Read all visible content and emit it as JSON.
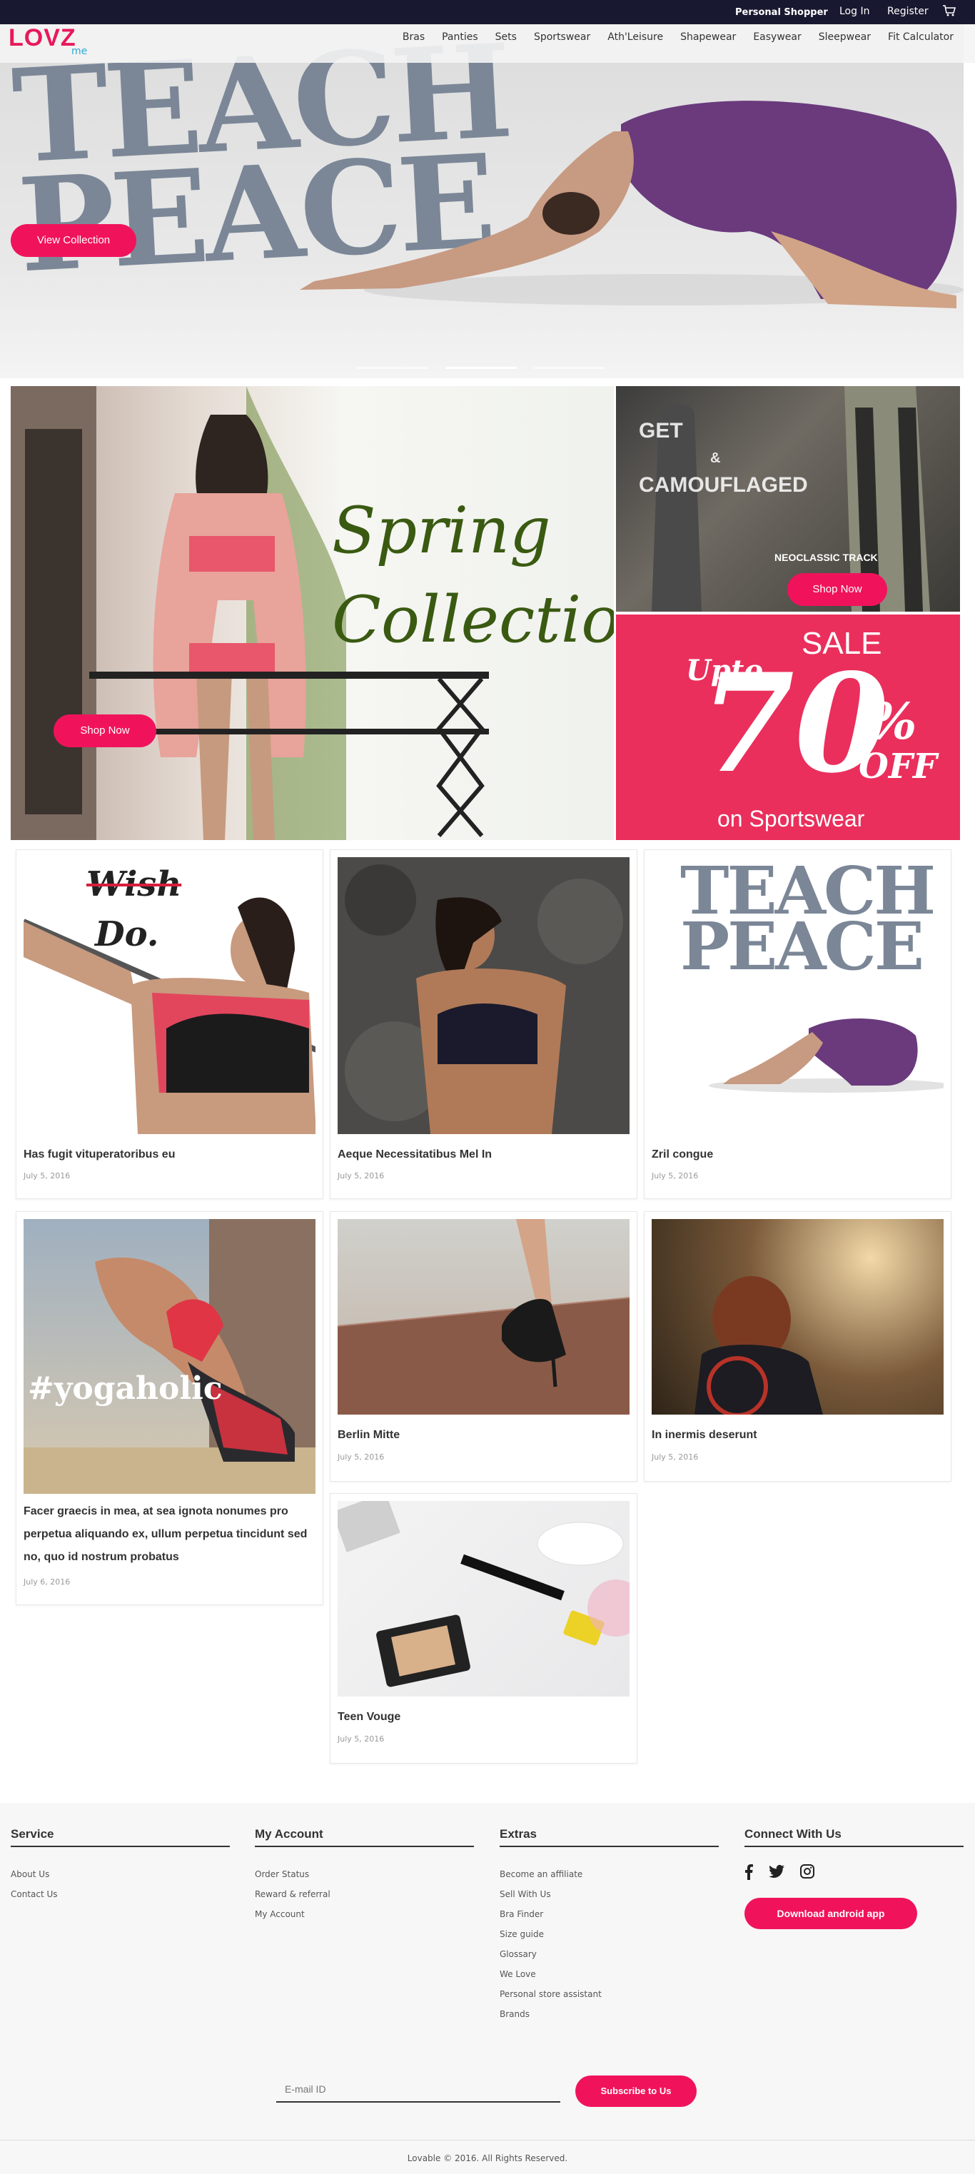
{
  "topbar": {
    "personal_shopper": "Personal Shopper",
    "login": "Log In",
    "register": "Register"
  },
  "logo": {
    "main": "LOVZ",
    "sub": "me"
  },
  "nav": [
    "Bras",
    "Panties",
    "Sets",
    "Sportswear",
    "Ath'Leisure",
    "Shapewear",
    "Easywear",
    "Sleepwear",
    "Fit Calculator"
  ],
  "hero": {
    "headline": "TEACH PEACE",
    "button": "View Collection",
    "slide_index": 1
  },
  "promo": {
    "spring": {
      "line1": "Spring",
      "line2": "Collection",
      "button": "Shop Now"
    },
    "camo": {
      "line1": "GET",
      "line2": "&",
      "line3": "CAMOUFLAGED",
      "sub": "NEOCLASSIC TRACK",
      "button": "Shop Now"
    },
    "sale": {
      "label": "SALE",
      "upto": "Upto",
      "number": "70",
      "percent": "%",
      "off": "OFF",
      "on": "on Sportswear"
    }
  },
  "posts": [
    {
      "title": "Has fugit vituperatoribus eu",
      "date": "July 5, 2016"
    },
    {
      "title": "Aeque Necessitatibus Mel In",
      "date": "July 5, 2016"
    },
    {
      "title": "Zril congue",
      "date": "July 5, 2016"
    },
    {
      "title": "Facer graecis in mea, at sea ignota nonumes pro perpetua aliquando ex, ullum perpetua tincidunt sed no, quo id nostrum probatus",
      "date": "July 6, 2016"
    },
    {
      "title": "Berlin Mitte",
      "date": "July 5, 2016"
    },
    {
      "title": "In inermis deserunt",
      "date": "July 5, 2016"
    },
    {
      "title": "Teen Vouge",
      "date": "July 5, 2016"
    }
  ],
  "overlays": {
    "wish": "Wish",
    "do": "Do.",
    "peach": "TEACH PEACE",
    "yoga": "#yogaholic"
  },
  "footer": {
    "service": {
      "heading": "Service",
      "links": [
        "About Us",
        "Contact Us"
      ]
    },
    "account": {
      "heading": "My Account",
      "links": [
        "Order Status",
        "Reward & referral",
        "My Account"
      ]
    },
    "extras": {
      "heading": "Extras",
      "links": [
        "Become an affiliate",
        "Sell With Us",
        "Bra Finder",
        "Size guide",
        "Glossary",
        "We Love",
        "Personal store assistant",
        "Brands"
      ]
    },
    "connect": {
      "heading": "Connect With Us",
      "download": "Download android app"
    },
    "newsletter": {
      "placeholder": "E-mail ID",
      "button": "Subscribe to Us"
    },
    "copyright": "Lovable © 2016. All Rights Reserved."
  }
}
